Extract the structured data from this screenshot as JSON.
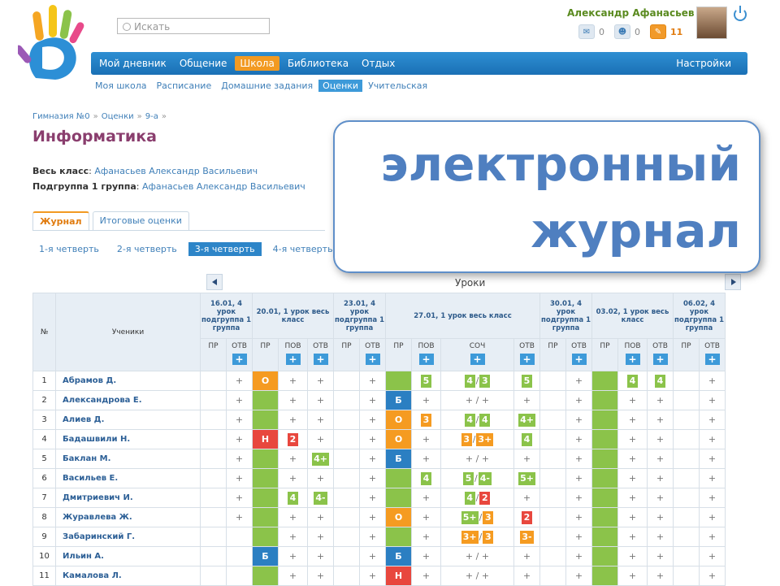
{
  "header": {
    "search_placeholder": "Искать",
    "user_name": "Александр Афанасьев",
    "counters": [
      {
        "icon": "envelope-icon",
        "value": "0"
      },
      {
        "icon": "person-icon",
        "value": "0"
      },
      {
        "icon": "notification-icon",
        "value": "11",
        "alert": true
      }
    ]
  },
  "nav": {
    "items": [
      {
        "label": "Мой дневник"
      },
      {
        "label": "Общение"
      },
      {
        "label": "Школа",
        "active": true
      },
      {
        "label": "Библиотека"
      },
      {
        "label": "Отдых"
      }
    ],
    "settings": "Настройки"
  },
  "subnav": [
    {
      "label": "Моя школа"
    },
    {
      "label": "Расписание"
    },
    {
      "label": "Домашние задания"
    },
    {
      "label": "Оценки",
      "active": true
    },
    {
      "label": "Учительская"
    }
  ],
  "breadcrumb": [
    "Гимназия №0",
    "Оценки",
    "9-а"
  ],
  "title": "Информатика",
  "meta": {
    "class_label": "Весь класс",
    "class_teacher": "Афанасьев Александр Васильевич",
    "group_label": "Подгруппа 1 группа",
    "group_teacher": "Афанасьев Александр Васильевич"
  },
  "tabs": [
    {
      "label": "Журнал",
      "active": true
    },
    {
      "label": "Итоговые оценки"
    }
  ],
  "quarters": [
    {
      "label": "1-я четверть"
    },
    {
      "label": "2-я четверть"
    },
    {
      "label": "3-я четверть",
      "active": true
    },
    {
      "label": "4-я четверть"
    }
  ],
  "callout": {
    "line1": "электронный",
    "line2": "журнал"
  },
  "lessons_label": "Уроки",
  "table": {
    "col_num": "№",
    "col_students": "Ученики",
    "lessons": [
      {
        "date": "16.01, 4 урок подгруппа 1 группа",
        "cols": [
          "ПР",
          "ОТВ"
        ]
      },
      {
        "date": "20.01, 1 урок весь класс",
        "cols": [
          "ПР",
          "ПОВ",
          "ОТВ"
        ]
      },
      {
        "date": "23.01, 4 урок подгруппа 1 группа",
        "cols": [
          "ПР",
          "ОТВ"
        ]
      },
      {
        "date": "27.01, 1 урок весь класс",
        "cols": [
          "ПР",
          "ПОВ",
          "СОЧ",
          "ОТВ"
        ]
      },
      {
        "date": "30.01, 4 урок подгруппа 1 группа",
        "cols": [
          "ПР",
          "ОТВ"
        ]
      },
      {
        "date": "03.02, 1 урок весь класс",
        "cols": [
          "ПР",
          "ПОВ",
          "ОТВ"
        ]
      },
      {
        "date": "06.02, 4 урок подгруппа 1 группа",
        "cols": [
          "ПР",
          "ОТВ"
        ]
      }
    ],
    "plus": "+",
    "rows": [
      {
        "n": "1",
        "name": "Абрамов Д.",
        "cells": [
          "",
          "+",
          "o:О",
          "+",
          "+",
          "",
          "+",
          "g:",
          "G:5",
          "GG:4|O3",
          "G:5",
          "",
          "+",
          "g:",
          "G:4",
          "G:4",
          "",
          "+"
        ]
      },
      {
        "n": "2",
        "name": "Александрова Е.",
        "cells": [
          "",
          "+",
          "g:",
          "+",
          "+",
          "",
          "+",
          "b:Б",
          "+",
          "+ / +",
          "+",
          "",
          "+",
          "g:",
          "+",
          "+",
          "",
          "+"
        ]
      },
      {
        "n": "3",
        "name": "Алиев Д.",
        "cells": [
          "",
          "+",
          "g:",
          "+",
          "+",
          "",
          "+",
          "o:О",
          "O:3",
          "GG:4|G4",
          "G:4+",
          "",
          "+",
          "g:",
          "+",
          "+",
          "",
          "+"
        ]
      },
      {
        "n": "4",
        "name": "Бадашвили Н.",
        "cells": [
          "",
          "+",
          "r:Н",
          "R:2",
          "+",
          "",
          "+",
          "o:О",
          "+",
          "OO:3|O3+",
          "G:4",
          "",
          "+",
          "g:",
          "+",
          "+",
          "",
          "+"
        ]
      },
      {
        "n": "5",
        "name": "Баклан М.",
        "cells": [
          "",
          "+",
          "g:",
          "+",
          "G:4+",
          "",
          "+",
          "b:Б",
          "+",
          "+ / +",
          "+",
          "",
          "+",
          "g:",
          "+",
          "+",
          "",
          "+"
        ]
      },
      {
        "n": "6",
        "name": "Васильев Е.",
        "cells": [
          "",
          "+",
          "g:",
          "+",
          "+",
          "",
          "+",
          "g:",
          "G:4",
          "GG:5|G4-",
          "G:5+",
          "",
          "+",
          "g:",
          "+",
          "+",
          "",
          "+"
        ]
      },
      {
        "n": "7",
        "name": "Дмитриевич И.",
        "cells": [
          "",
          "+",
          "g:",
          "G:4",
          "G:4-",
          "",
          "+",
          "g:",
          "+",
          "GR:4|R2",
          "+",
          "",
          "+",
          "g:",
          "+",
          "+",
          "",
          "+"
        ]
      },
      {
        "n": "8",
        "name": "Журавлева Ж.",
        "cells": [
          "",
          "+",
          "g:",
          "+",
          "+",
          "",
          "+",
          "o:О",
          "+",
          "GO:5+|O3",
          "R:2",
          "",
          "+",
          "g:",
          "+",
          "+",
          "",
          "+"
        ]
      },
      {
        "n": "9",
        "name": "Забаринский Г.",
        "cells": [
          "",
          "",
          "g:",
          "+",
          "+",
          "",
          "+",
          "g:",
          "+",
          "OO:3+|O3",
          "O:3-",
          "",
          "+",
          "g:",
          "+",
          "+",
          "",
          "+"
        ]
      },
      {
        "n": "10",
        "name": "Ильин А.",
        "cells": [
          "",
          "",
          "b:Б",
          "+",
          "+",
          "",
          "+",
          "b:Б",
          "+",
          "+ / +",
          "+",
          "",
          "+",
          "g:",
          "+",
          "+",
          "",
          "+"
        ]
      },
      {
        "n": "11",
        "name": "Камалова Л.",
        "cells": [
          "",
          "",
          "g:",
          "+",
          "+",
          "",
          "+",
          "r:Н",
          "+",
          "+ / +",
          "+",
          "",
          "+",
          "g:",
          "+",
          "+",
          "",
          "+"
        ]
      }
    ]
  },
  "colors": {
    "nav_blue": "#1f7cc2",
    "accent_orange": "#f29a22",
    "green": "#8bc34a",
    "red": "#e8473e",
    "title_purple": "#8a3e6e",
    "callout_text": "#4f7fc0"
  }
}
